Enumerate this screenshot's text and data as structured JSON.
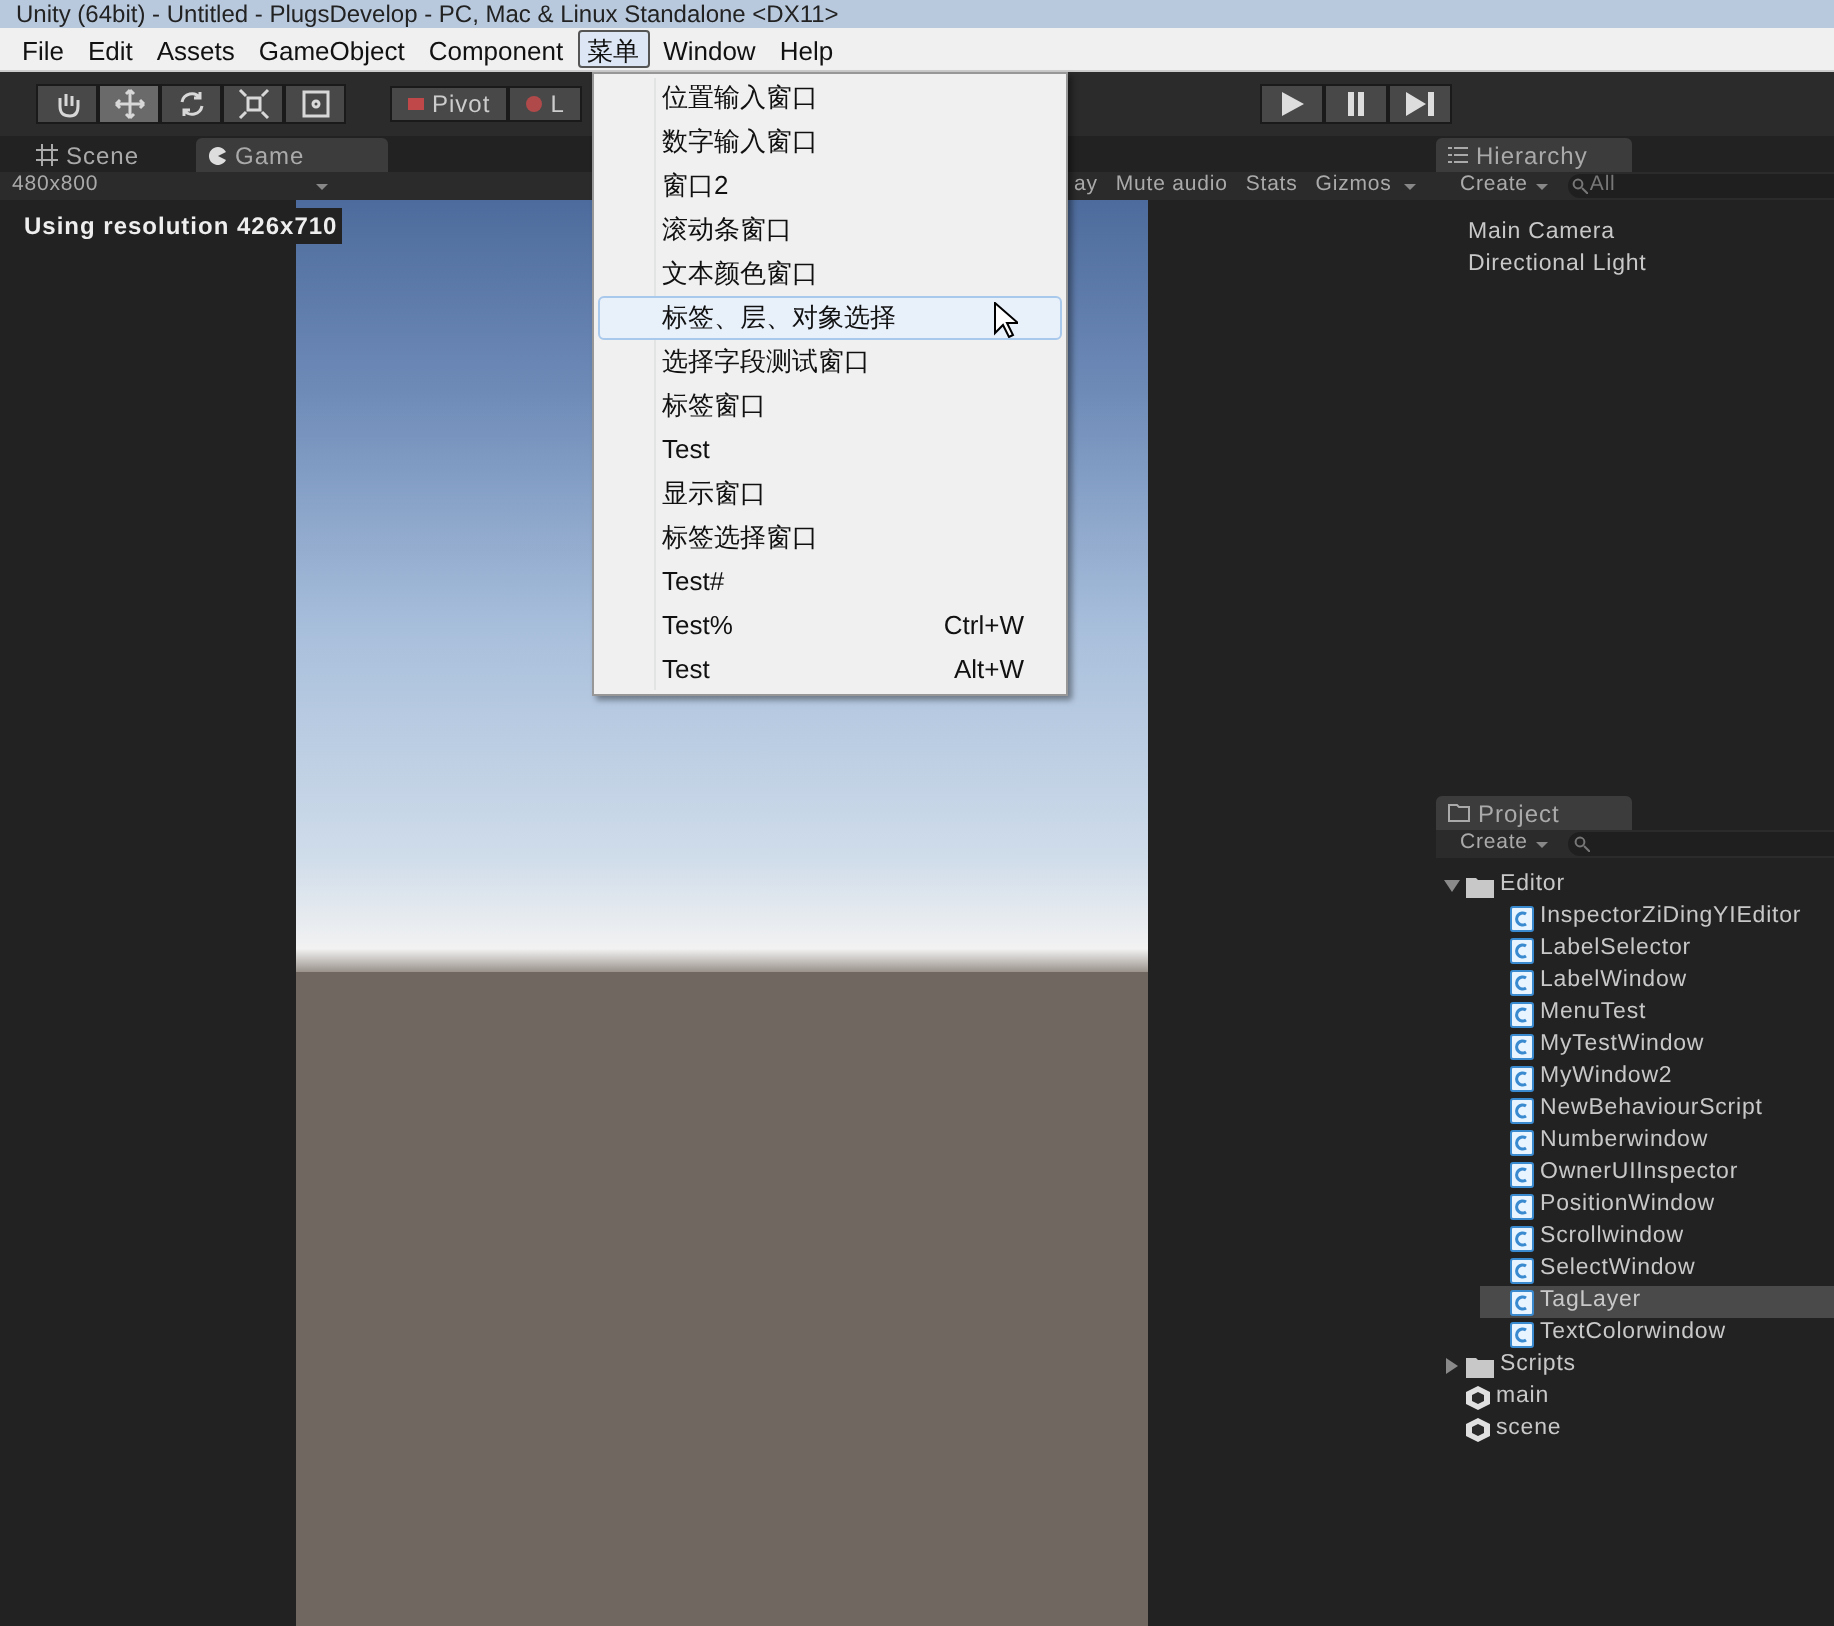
{
  "window": {
    "title": "Unity (64bit) - Untitled - PlugsDevelop - PC, Mac & Linux Standalone <DX11>"
  },
  "menu_bar": [
    {
      "label": "File",
      "selected": false
    },
    {
      "label": "Edit",
      "selected": false
    },
    {
      "label": "Assets",
      "selected": false
    },
    {
      "label": "GameObject",
      "selected": false
    },
    {
      "label": "Component",
      "selected": false
    },
    {
      "label": "菜单",
      "selected": true
    },
    {
      "label": "Window",
      "selected": false
    },
    {
      "label": "Help",
      "selected": false
    }
  ],
  "toolbar": {
    "tools": [
      {
        "kind": "hand",
        "selected": false
      },
      {
        "kind": "move",
        "selected": true
      },
      {
        "kind": "rotate",
        "selected": false
      },
      {
        "kind": "scale",
        "selected": false
      },
      {
        "kind": "rect",
        "selected": false
      }
    ],
    "pivot": "Pivot",
    "local": "L"
  },
  "game_panel": {
    "tabs": [
      {
        "label": "Scene",
        "kind": "scene",
        "selected": false
      },
      {
        "label": "Game",
        "kind": "game",
        "selected": true
      }
    ],
    "aspect": "480x800",
    "options": [
      "ay",
      "Mute audio",
      "Stats",
      "Gizmos"
    ],
    "status": "Using resolution 426x710"
  },
  "dropdown_menu": {
    "items": [
      {
        "label": "位置输入窗口",
        "selected": false
      },
      {
        "label": "数字输入窗口",
        "selected": false
      },
      {
        "label": "窗口2",
        "selected": false
      },
      {
        "label": "滚动条窗口",
        "selected": false
      },
      {
        "label": "文本颜色窗口",
        "selected": false
      },
      {
        "label": "标签、层、对象选择",
        "selected": true
      },
      {
        "label": "选择字段测试窗口",
        "selected": false
      },
      {
        "label": "标签窗口",
        "selected": false
      },
      {
        "label": "Test",
        "selected": false
      },
      {
        "label": "显示窗口",
        "selected": false
      },
      {
        "label": "标签选择窗口",
        "selected": false
      },
      {
        "label": "Test#",
        "selected": false
      },
      {
        "label": "Test%",
        "shortcut": "Ctrl+W",
        "selected": false
      },
      {
        "label": "Test",
        "shortcut": "Alt+W",
        "selected": false
      }
    ]
  },
  "hierarchy": {
    "tab": "Hierarchy",
    "create": "Create",
    "search_placeholder": "All",
    "items": [
      "Main Camera",
      "Directional Light"
    ]
  },
  "project": {
    "tab": "Project",
    "create": "Create",
    "tree": [
      {
        "label": "Editor",
        "kind": "folder",
        "expanded": true,
        "selected": false,
        "children": [
          {
            "label": "InspectorZiDingYIEditor",
            "kind": "script",
            "selected": false
          },
          {
            "label": "LabelSelector",
            "kind": "script",
            "selected": false
          },
          {
            "label": "LabelWindow",
            "kind": "script",
            "selected": false
          },
          {
            "label": "MenuTest",
            "kind": "script",
            "selected": false
          },
          {
            "label": "MyTestWindow",
            "kind": "script",
            "selected": false
          },
          {
            "label": "MyWindow2",
            "kind": "script",
            "selected": false
          },
          {
            "label": "NewBehaviourScript",
            "kind": "script",
            "selected": false
          },
          {
            "label": "Numberwindow",
            "kind": "script",
            "selected": false
          },
          {
            "label": "OwnerUIInspector",
            "kind": "script",
            "selected": false
          },
          {
            "label": "PositionWindow",
            "kind": "script",
            "selected": false
          },
          {
            "label": "Scrollwindow",
            "kind": "script",
            "selected": false
          },
          {
            "label": "SelectWindow",
            "kind": "script",
            "selected": false
          },
          {
            "label": "TagLayer",
            "kind": "script",
            "selected": true
          },
          {
            "label": "TextColorwindow",
            "kind": "script",
            "selected": false
          }
        ]
      },
      {
        "label": "Scripts",
        "kind": "folder",
        "expanded": false,
        "selected": false
      },
      {
        "label": "main",
        "kind": "scene",
        "selected": false
      },
      {
        "label": "scene",
        "kind": "scene",
        "selected": false
      }
    ]
  }
}
